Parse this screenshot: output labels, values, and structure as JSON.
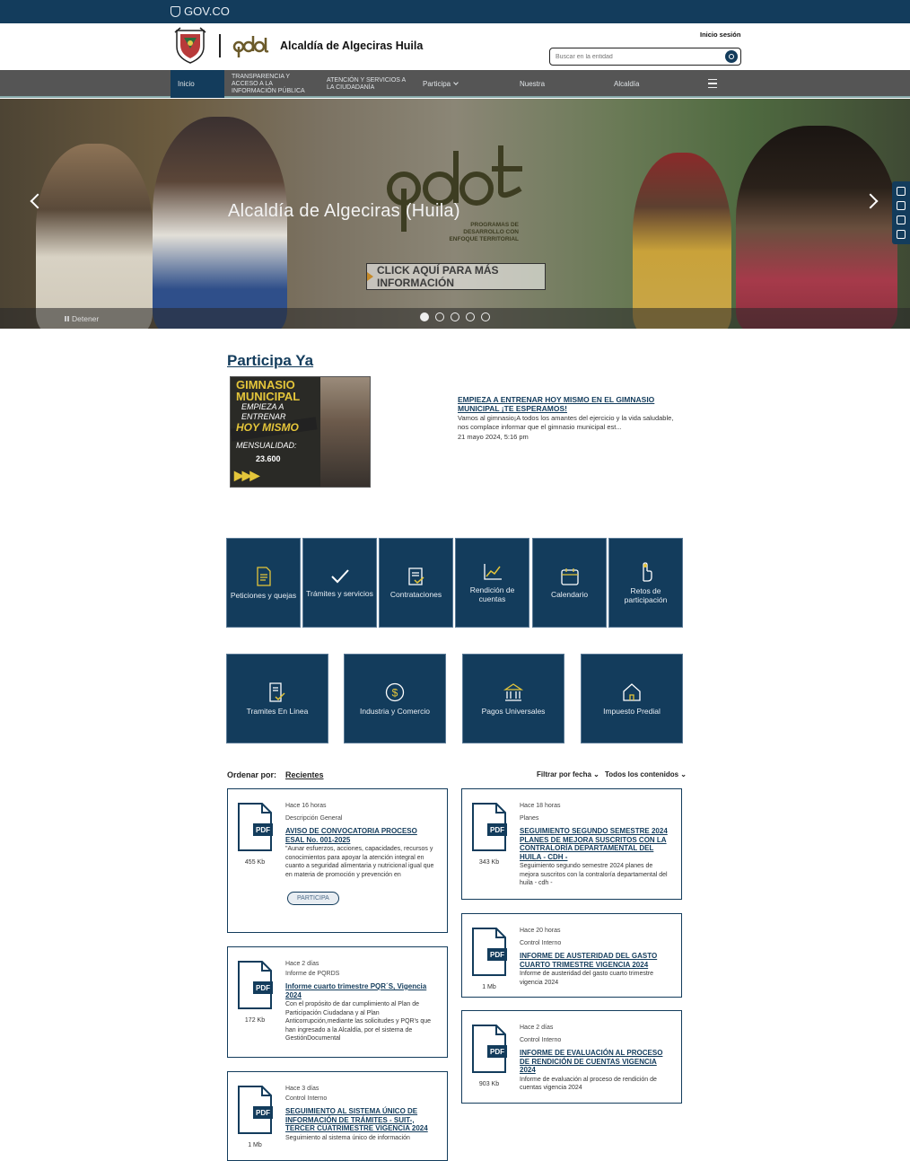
{
  "gov_bar": {
    "label": "GOV.CO"
  },
  "header": {
    "title": "Alcaldía de Algeciras Huila",
    "login": "Inicio sesión",
    "search_placeholder": "Buscar en la entidad"
  },
  "nav": {
    "items": [
      {
        "label": "Inicio"
      },
      {
        "label": "TRANSPARENCIA Y ACCESO A LA INFORMACIÓN PÚBLICA"
      },
      {
        "label": "ATENCIÓN Y SERVICIOS A LA CIUDADANÍA"
      },
      {
        "label": "Participa"
      },
      {
        "label": "Nuestra"
      },
      {
        "label": "Alcaldía"
      }
    ]
  },
  "hero": {
    "title": "Alcaldía de Algeciras (Huila)",
    "pdet_subtitle": "PROGRAMAS DE DESARROLLO CON ENFOQUE TERRITORIAL",
    "cta": "CLICK AQUÍ PARA MÁS INFORMACIÓN",
    "stop": "Detener"
  },
  "participa": {
    "title": "Participa Ya",
    "image_text": {
      "l1": "GIMNASIO MUNICIPAL",
      "l2": "EMPIEZA A ENTRENAR",
      "l3": "HOY MISMO",
      "l4": "MENSUALIDAD:",
      "l5": "23.600"
    },
    "feature": {
      "title": "EMPIEZA A ENTRENAR HOY MISMO EN EL GIMNASIO MUNICIPAL ¡TE ESPERAMOS!",
      "description": "Vamos al gimnasio¡A todos los amantes del ejercicio y la vida saludable, nos complace informar que el gimnasio municipal est...",
      "date": "21 mayo 2024, 5:16 pm"
    }
  },
  "tiles_row1": [
    {
      "label": "Peticiones y quejas",
      "icon": "document-icon"
    },
    {
      "label": "Trámites y servicios",
      "icon": "check-icon"
    },
    {
      "label": "Contrataciones",
      "icon": "contract-icon"
    },
    {
      "label": "Rendición de cuentas",
      "icon": "chart-icon"
    },
    {
      "label": "Calendario",
      "icon": "calendar-icon"
    },
    {
      "label": "Retos de participación",
      "icon": "hand-icon"
    }
  ],
  "tiles_row2": [
    {
      "label": "Tramites En Linea",
      "icon": "online-procedure-icon"
    },
    {
      "label": "Industria y Comercio",
      "icon": "dollar-icon"
    },
    {
      "label": "Pagos Universales",
      "icon": "bank-icon"
    },
    {
      "label": "Impuesto Predial",
      "icon": "house-icon"
    }
  ],
  "sort": {
    "label": "Ordenar por:",
    "value": "Recientes",
    "filter_date": "Filtrar por fecha",
    "filter_content": "Todos los contenidos"
  },
  "cards_left": [
    {
      "time": "Hace 16 horas",
      "category": "Descripción General",
      "title": "AVISO DE CONVOCATORIA PROCESO ESAL No. 001-2025",
      "description": "\"Aunar esfuerzos, acciones, capacidades, recursos y conocimientos para apoyar la atención integral en cuanto a seguridad alimentaria y nutricional igual que en materia de promoción y prevención en",
      "size": "455 Kb",
      "button": "PARTICIPA"
    },
    {
      "time": "Hace 2 días",
      "category": "Informe de PQRDS",
      "title": "Informe cuarto trimestre PQR´S, Vigencia 2024",
      "description": "Con el propósito de dar cumplimiento al Plan de Participación Ciudadana y al Plan Anticorrupción,mediante las solicitudes y PQR's que han ingresado a la Alcaldía, por el sistema de GestiónDocumental",
      "size": "172 Kb"
    },
    {
      "time": "Hace 3 días",
      "category": "Control Interno",
      "title": "SEGUIMIENTO AL SISTEMA ÚNICO DE INFORMACIÓN DE TRÁMITES - SUIT-, TERCER CUATRIMESTRE VIGENCIA 2024",
      "description": "Seguimiento al sistema único de información",
      "size": "1 Mb"
    }
  ],
  "cards_right": [
    {
      "time": "Hace 18 horas",
      "category": "Planes",
      "title": "SEGUIMIENTO SEGUNDO SEMESTRE 2024 PLANES DE MEJORA SUSCRITOS CON LA CONTRALORÍA DEPARTAMENTAL DEL HUILA - CDH -",
      "description": "Seguimiento segundo semestre 2024 planes de mejora suscritos con la contraloría departamental del huila - cdh -",
      "size": "343 Kb"
    },
    {
      "time": "Hace 20 horas",
      "category": "Control Interno",
      "title": "INFORME DE AUSTERIDAD DEL GASTO CUARTO TRIMESTRE VIGENCIA 2024",
      "description": "Informe de austeridad del gasto cuarto trimestre vigencia 2024",
      "size": "1 Mb"
    },
    {
      "time": "Hace 2 días",
      "category": "Control Interno",
      "title": "INFORME DE EVALUACIÓN AL PROCESO DE RENDICIÓN DE CUENTAS VIGENCIA 2024",
      "description": "Informe de evaluación al proceso de rendición de cuentas vigencia 2024",
      "size": "903 Kb"
    }
  ],
  "colors": {
    "primary": "#133c5c",
    "nav": "#555555",
    "accent": "#e4c53a"
  }
}
